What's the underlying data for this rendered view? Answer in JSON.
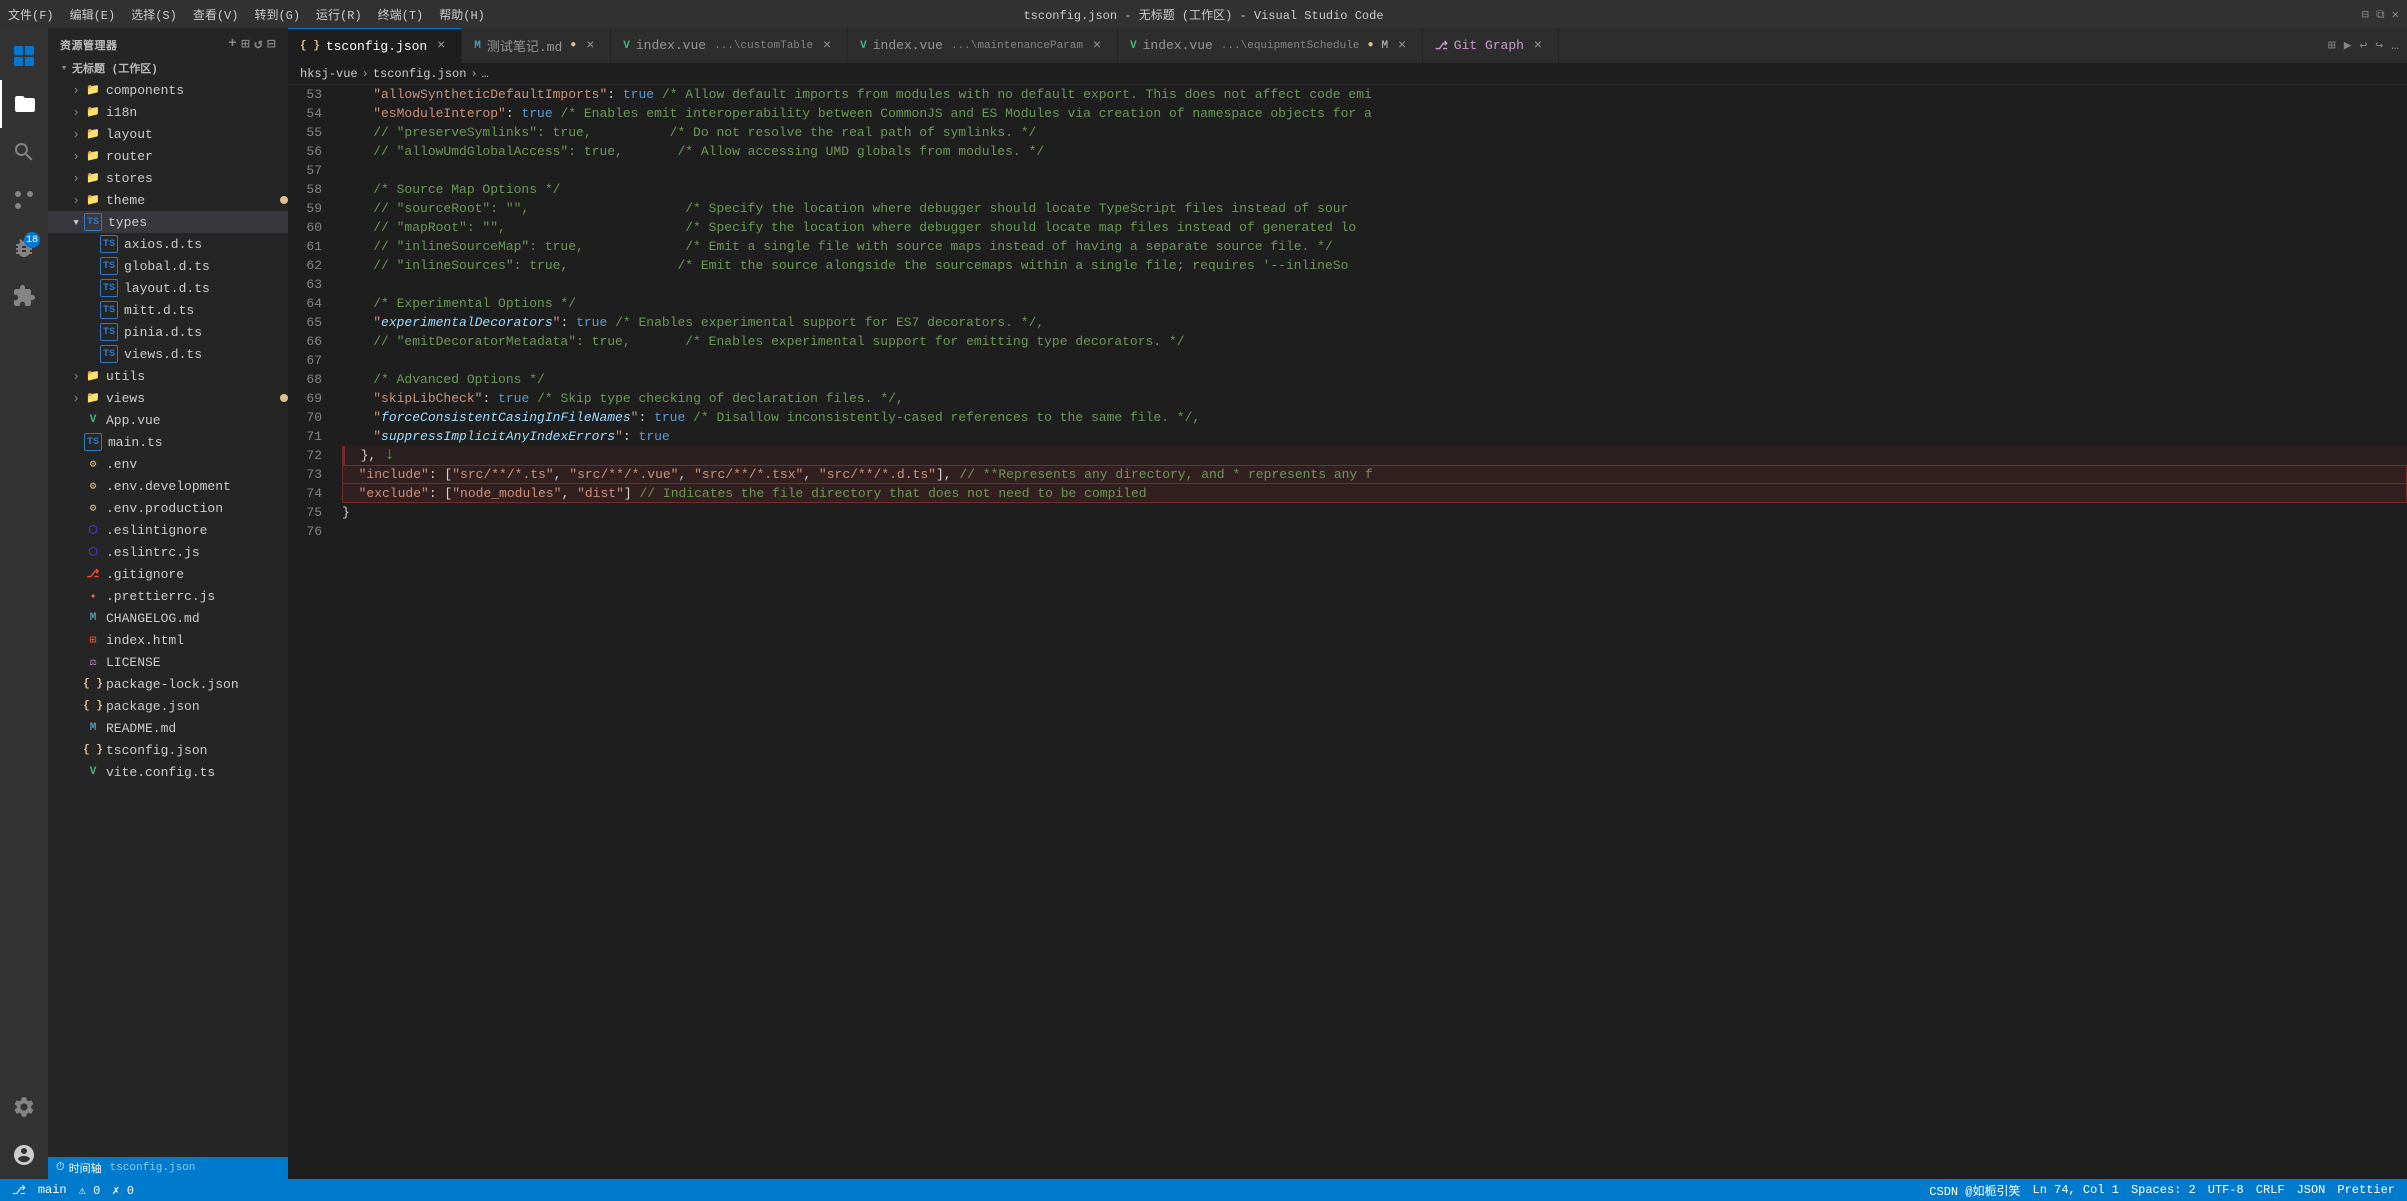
{
  "titlebar": {
    "title": "tsconfig.json - 无标题 (工作区) - Visual Studio Code",
    "menu_items": [
      "文件(F)",
      "编辑(E)",
      "选择(S)",
      "查看(V)",
      "转到(G)",
      "运行(R)",
      "终端(T)",
      "帮助(H)"
    ]
  },
  "sidebar": {
    "title": "资源管理器",
    "workspace_title": "无标题 (工作区)",
    "tree": [
      {
        "id": "components",
        "label": "components",
        "type": "folder",
        "indent": 1,
        "expanded": false
      },
      {
        "id": "i18n",
        "label": "i18n",
        "type": "folder",
        "indent": 1,
        "expanded": false
      },
      {
        "id": "layout",
        "label": "layout",
        "type": "folder",
        "indent": 1,
        "expanded": false,
        "modified": true
      },
      {
        "id": "router",
        "label": "router",
        "type": "folder",
        "indent": 1,
        "expanded": false
      },
      {
        "id": "stores",
        "label": "stores",
        "type": "folder",
        "indent": 1,
        "expanded": false
      },
      {
        "id": "theme",
        "label": "theme",
        "type": "folder",
        "indent": 1,
        "expanded": false,
        "dot": "yellow"
      },
      {
        "id": "types",
        "label": "types",
        "type": "folder-ts",
        "indent": 1,
        "expanded": true,
        "selected": true
      },
      {
        "id": "axios.d.ts",
        "label": "axios.d.ts",
        "type": "ts",
        "indent": 3
      },
      {
        "id": "global.d.ts",
        "label": "global.d.ts",
        "type": "ts",
        "indent": 3
      },
      {
        "id": "layout.d.ts",
        "label": "layout.d.ts",
        "type": "ts",
        "indent": 3
      },
      {
        "id": "mitt.d.ts",
        "label": "mitt.d.ts",
        "type": "ts",
        "indent": 3
      },
      {
        "id": "pinia.d.ts",
        "label": "pinia.d.ts",
        "type": "ts",
        "indent": 3
      },
      {
        "id": "views.d.ts",
        "label": "views.d.ts",
        "type": "ts",
        "indent": 3
      },
      {
        "id": "utils",
        "label": "utils",
        "type": "folder",
        "indent": 1,
        "expanded": false
      },
      {
        "id": "views",
        "label": "views",
        "type": "folder",
        "indent": 1,
        "expanded": false,
        "dot": "yellow"
      },
      {
        "id": "App.vue",
        "label": "App.vue",
        "type": "vue",
        "indent": 2
      },
      {
        "id": "main.ts",
        "label": "main.ts",
        "type": "ts",
        "indent": 2
      },
      {
        "id": ".env",
        "label": ".env",
        "type": "env",
        "indent": 2
      },
      {
        "id": ".env.development",
        "label": ".env.development",
        "type": "env",
        "indent": 2
      },
      {
        "id": ".env.production",
        "label": ".env.production",
        "type": "env",
        "indent": 2
      },
      {
        "id": ".eslintignore",
        "label": ".eslintignore",
        "type": "eslint",
        "indent": 2
      },
      {
        "id": ".eslintrc.js",
        "label": ".eslintrc.js",
        "type": "eslint",
        "indent": 2,
        "arrow": true
      },
      {
        "id": ".gitignore",
        "label": ".gitignore",
        "type": "git",
        "indent": 2
      },
      {
        "id": ".prettierrc.js",
        "label": ".prettierrc.js",
        "type": "prettier",
        "indent": 2
      },
      {
        "id": "CHANGELOG.md",
        "label": "CHANGELOG.md",
        "type": "md",
        "indent": 2
      },
      {
        "id": "index.html",
        "label": "index.html",
        "type": "html",
        "indent": 2
      },
      {
        "id": "LICENSE",
        "label": "LICENSE",
        "type": "generic",
        "indent": 2
      },
      {
        "id": "package-lock.json",
        "label": "package-lock.json",
        "type": "json",
        "indent": 2
      },
      {
        "id": "package.json",
        "label": "package.json",
        "type": "json",
        "indent": 2
      },
      {
        "id": "README.md",
        "label": "README.md",
        "type": "md",
        "indent": 2
      },
      {
        "id": "tsconfig.json",
        "label": "tsconfig.json",
        "type": "json",
        "indent": 2
      },
      {
        "id": "vite.config.ts",
        "label": "vite.config.ts",
        "type": "vue",
        "indent": 2
      }
    ]
  },
  "tabs": [
    {
      "id": "tsconfig",
      "label": "tsconfig.json",
      "type": "json",
      "active": true,
      "modified": false
    },
    {
      "id": "测试笔记",
      "label": "测试笔记.md",
      "type": "md",
      "active": false,
      "modified": true
    },
    {
      "id": "index-custom",
      "label": "index.vue",
      "subtitle": "...\\customTable",
      "type": "vue",
      "active": false
    },
    {
      "id": "index-maint",
      "label": "index.vue",
      "subtitle": "...\\maintenanceParam",
      "type": "vue",
      "active": false
    },
    {
      "id": "index-equip",
      "label": "index.vue",
      "subtitle": "...\\equipmentSchedule",
      "type": "vue",
      "active": false,
      "modified": true
    },
    {
      "id": "git-graph",
      "label": "Git Graph",
      "type": "git",
      "active": false
    }
  ],
  "breadcrumb": {
    "items": [
      "hksj-vue",
      ">",
      "tsconfig.json",
      ">",
      "..."
    ]
  },
  "editor": {
    "lines": [
      {
        "num": 53,
        "content": "    \"allowSyntheticDefaultImports\": true /* Allow default imports from modules with no default export. This does not affect code emi"
      },
      {
        "num": 54,
        "content": "    \"esModuleInterop\": true /* Enables emit interoperability between CommonJS and ES Modules via creation of namespace objects for a"
      },
      {
        "num": 55,
        "content": "    // \"preserveSymlinks\": true,          /* Do not resolve the real path of symlinks. */"
      },
      {
        "num": 56,
        "content": "    // \"allowUmdGlobalAccess\": true,       /* Allow accessing UMD globals from modules. */"
      },
      {
        "num": 57,
        "content": ""
      },
      {
        "num": 58,
        "content": "    /* Source Map Options */"
      },
      {
        "num": 59,
        "content": "    // \"sourceRoot\": \"\",                    /* Specify the location where debugger should locate TypeScript files instead of sour"
      },
      {
        "num": 60,
        "content": "    // \"mapRoot\": \"\",                       /* Specify the location where debugger should locate map files instead of generated lo"
      },
      {
        "num": 61,
        "content": "    // \"inlineSourceMap\": true,             /* Emit a single file with source maps instead of having a separate source file. */"
      },
      {
        "num": 62,
        "content": "    // \"inlineSources\": true,              /* Emit the source alongside the sourcemaps within a single file; requires '--inlineSo"
      },
      {
        "num": 63,
        "content": ""
      },
      {
        "num": 64,
        "content": "    /* Experimental Options */"
      },
      {
        "num": 65,
        "content": "    \"experimentalDecorators\": true /* Enables experimental support for ES7 decorators. */,"
      },
      {
        "num": 66,
        "content": "    // \"emitDecoratorMetadata\": true,       /* Enables experimental support for emitting type decorators. */"
      },
      {
        "num": 67,
        "content": ""
      },
      {
        "num": 68,
        "content": "    /* Advanced Options */"
      },
      {
        "num": 69,
        "content": "    \"skipLibCheck\": true /* Skip type checking of declaration files. */,"
      },
      {
        "num": 70,
        "content": "    \"forceConsistentCasingInFileNames\": true /* Disallow inconsistently-cased references to the same file. */,"
      },
      {
        "num": 71,
        "content": "    \"suppressImplicitAnyIndexErrors\": true"
      },
      {
        "num": 72,
        "content": "  },"
      },
      {
        "num": 73,
        "content": "  \"include\": [\"src/**/*.ts\", \"src/**/*.vue\", \"src/**/*.tsx\", \"src/**/*.d.ts\"], // **Represents any directory, and * represents any f"
      },
      {
        "num": 74,
        "content": "  \"exclude\": [\"node_modules\", \"dist\"] // Indicates the file directory that does not need to be compiled"
      },
      {
        "num": 75,
        "content": "}"
      },
      {
        "num": 76,
        "content": ""
      }
    ]
  },
  "status_bar": {
    "left": [
      "Git icon",
      "main",
      "⚠ 0",
      "✗ 0"
    ],
    "right": [
      "CSDN @如栀引笑",
      "Ln 74, Col 1",
      "Spaces: 2",
      "UTF-8",
      "CRLF",
      "JSON",
      "Prettier"
    ]
  }
}
